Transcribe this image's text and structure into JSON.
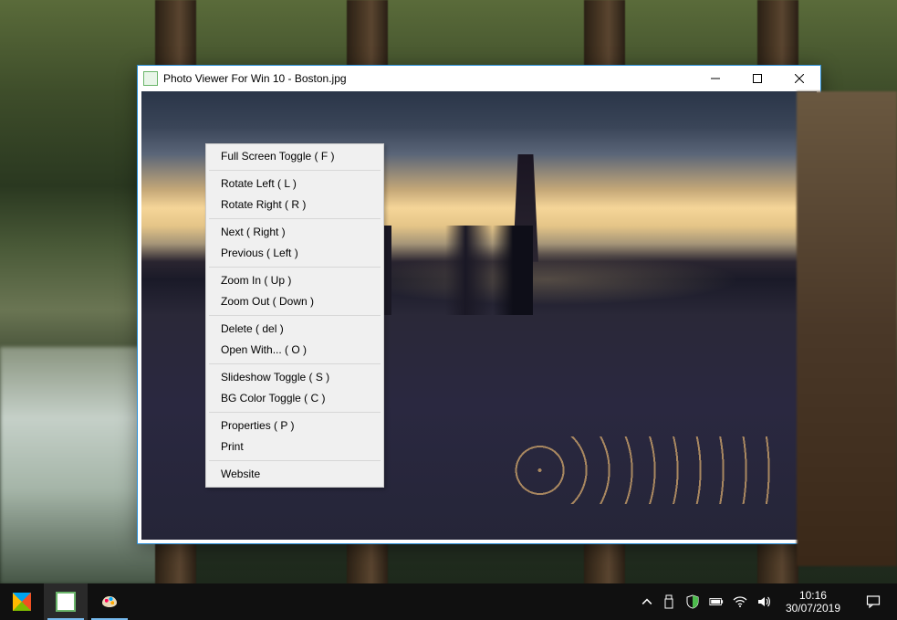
{
  "window": {
    "title": "Photo Viewer For Win 10 - Boston.jpg"
  },
  "context_menu": {
    "groups": [
      [
        "Full Screen Toggle  ( F )"
      ],
      [
        "Rotate Left  ( L )",
        "Rotate Right  ( R )"
      ],
      [
        "Next  ( Right )",
        "Previous  ( Left )"
      ],
      [
        "Zoom In  ( Up )",
        "Zoom Out  ( Down )"
      ],
      [
        "Delete  ( del )",
        "Open With...  ( O )"
      ],
      [
        "Slideshow Toggle ( S )",
        "BG Color Toggle  ( C )"
      ],
      [
        "Properties  ( P )",
        "Print"
      ],
      [
        "Website"
      ]
    ]
  },
  "taskbar": {
    "clock_time": "10:16",
    "clock_date": "30/07/2019"
  }
}
